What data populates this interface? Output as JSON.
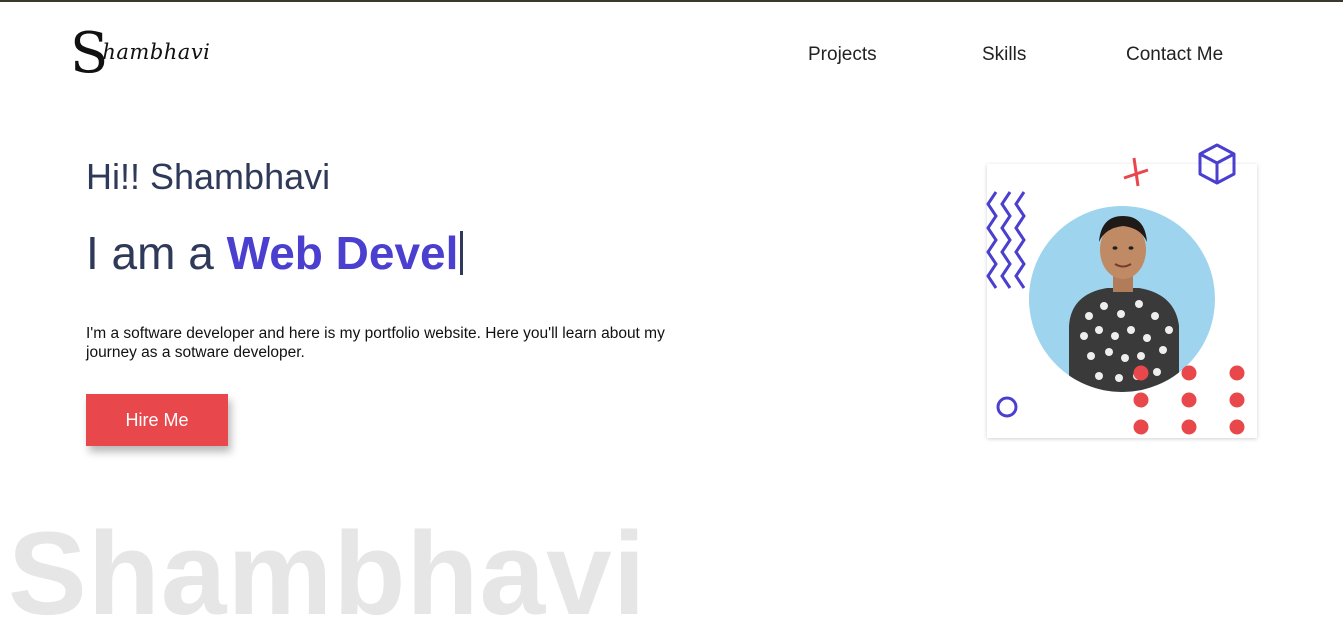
{
  "brand": {
    "logo_initial": "S",
    "logo_rest": "hambhavi"
  },
  "nav": [
    {
      "label": "Projects"
    },
    {
      "label": "Skills"
    },
    {
      "label": "Contact Me"
    }
  ],
  "hero": {
    "greeting": "Hi!! Shambhavi",
    "intro_prefix": "I am a ",
    "role_typed": "Web Devel",
    "bio": "I'm a software developer and here is my portfolio website. Here you'll learn about my journey as a sotware developer.",
    "cta_label": "Hire Me"
  },
  "watermark": "Shambhavi",
  "colors": {
    "accent": "#4a3fcf",
    "cta": "#e8474c",
    "text": "#2f3a5a",
    "avatar_bg": "#9ed4ee"
  }
}
